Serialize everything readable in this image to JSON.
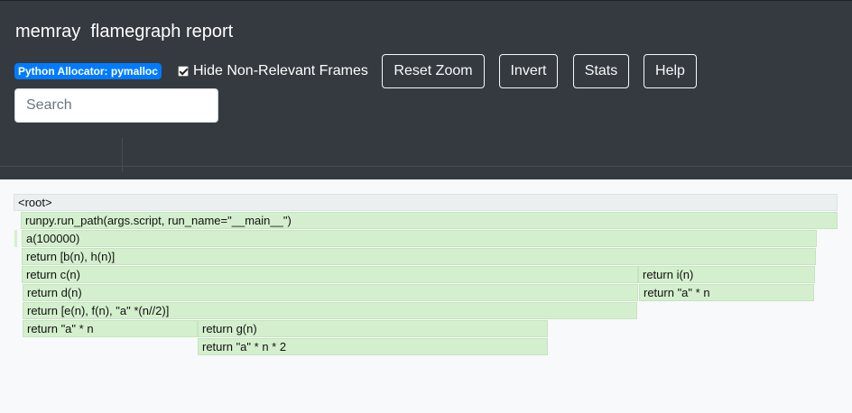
{
  "header": {
    "title": "memray  flamegraph report",
    "allocator_badge": "Python Allocator: pymalloc",
    "hide_frames_label": "Hide Non-Relevant Frames",
    "hide_frames_checked": true,
    "buttons": {
      "reset_zoom": "Reset Zoom",
      "invert": "Invert",
      "stats": "Stats",
      "help": "Help"
    },
    "search_placeholder": "Search"
  },
  "flamegraph": {
    "frames": {
      "root": "<root>",
      "run_path": "runpy.run_path(args.script, run_name=\"__main__\")",
      "a": "a(100000)",
      "return_bh": "return [b(n), h(n)]",
      "return_c": "return c(n)",
      "return_i": "return i(n)",
      "return_d": "return d(n)",
      "return_a_n_i": "return \"a\" * n",
      "return_efn": "return [e(n), f(n), \"a\" *(n//2)]",
      "return_a_n": "return \"a\" * n",
      "return_g": "return g(n)",
      "return_a_n_2": "return \"a\" * n * 2"
    }
  },
  "colors": {
    "navbar": "#343a40",
    "badge": "#007bff",
    "frame": "#d4efcd",
    "root_frame": "#eaeff0"
  }
}
